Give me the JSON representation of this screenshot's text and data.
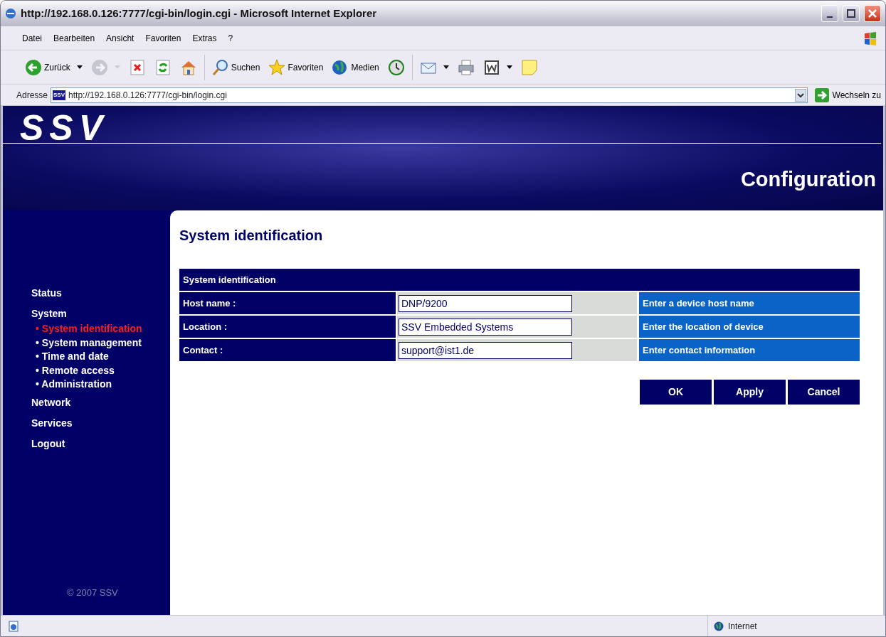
{
  "window": {
    "title": "http://192.168.0.126:7777/cgi-bin/login.cgi - Microsoft Internet Explorer"
  },
  "menu": [
    "Datei",
    "Bearbeiten",
    "Ansicht",
    "Favoriten",
    "Extras",
    "?"
  ],
  "toolbar": [
    {
      "kind": "back",
      "label": "Zurück",
      "dropdown": true,
      "disabled": false
    },
    {
      "kind": "forward",
      "dropdown": true,
      "disabled": true
    },
    {
      "kind": "stop",
      "dropdown": false,
      "disabled": false
    },
    {
      "kind": "refresh",
      "dropdown": false,
      "disabled": false
    },
    {
      "kind": "home",
      "dropdown": false,
      "disabled": false
    },
    {
      "kind": "separator"
    },
    {
      "kind": "search",
      "label": "Suchen",
      "dropdown": false,
      "disabled": false
    },
    {
      "kind": "favorites",
      "label": "Favoriten",
      "dropdown": false,
      "disabled": false
    },
    {
      "kind": "media",
      "label": "Medien",
      "dropdown": false,
      "disabled": false
    },
    {
      "kind": "history",
      "dropdown": false,
      "disabled": false
    },
    {
      "kind": "separator"
    },
    {
      "kind": "mail",
      "dropdown": true,
      "disabled": false
    },
    {
      "kind": "print",
      "dropdown": false,
      "disabled": false
    },
    {
      "kind": "edit",
      "dropdown": true,
      "disabled": false
    },
    {
      "kind": "note",
      "dropdown": false,
      "disabled": false
    }
  ],
  "address": {
    "label": "Adresse",
    "favicon": "SSV",
    "url": "http://192.168.0.126:7777/cgi-bin/login.cgi",
    "go": "Wechseln zu"
  },
  "banner": {
    "logo": "SSV",
    "title": "Configuration"
  },
  "sidebar": {
    "items": [
      {
        "label": "Status",
        "selected": false
      },
      {
        "label": "System",
        "selected": false,
        "children": [
          {
            "label": "• System identification",
            "selected": true
          },
          {
            "label": "• System management",
            "selected": false
          },
          {
            "label": "• Time and date",
            "selected": false
          },
          {
            "label": "• Remote access",
            "selected": false
          },
          {
            "label": "• Administration",
            "selected": false
          }
        ]
      },
      {
        "label": "Network",
        "selected": false
      },
      {
        "label": "Services",
        "selected": false
      },
      {
        "label": "Logout",
        "selected": false
      }
    ],
    "copyright": "© 2007 SSV"
  },
  "page": {
    "heading": "System identification",
    "form": {
      "title": "System identification",
      "fields": [
        {
          "label": "Host name :",
          "value": "DNP/9200",
          "hint": "Enter a device host name"
        },
        {
          "label": "Location :",
          "value": "SSV Embedded Systems",
          "hint": "Enter the location of device"
        },
        {
          "label": "Contact :",
          "value": "support@ist1.de",
          "hint": "Enter contact information"
        }
      ]
    },
    "buttons": [
      "OK",
      "Apply",
      "Cancel"
    ]
  },
  "status_bar": {
    "zone": "Internet"
  }
}
